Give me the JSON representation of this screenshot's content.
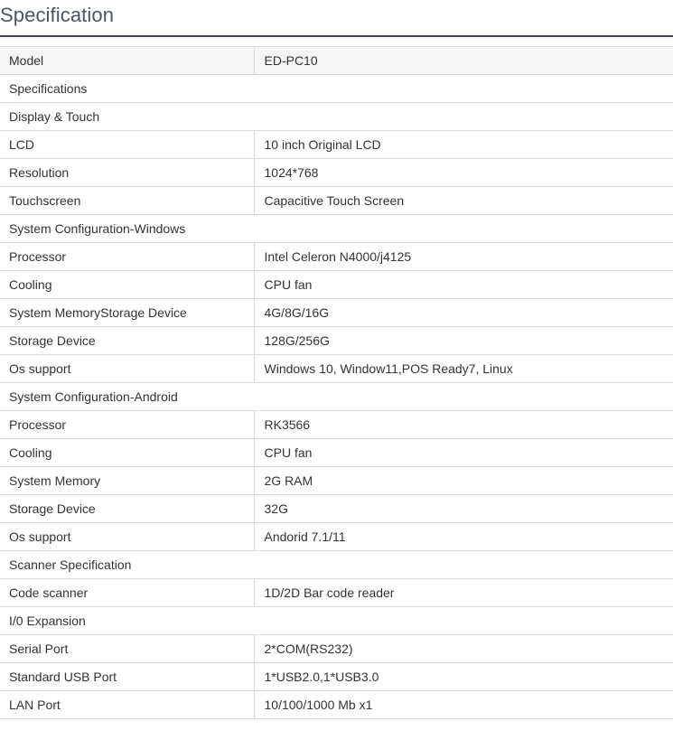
{
  "page": {
    "title": "Specification"
  },
  "table": {
    "rows": [
      {
        "type": "pair",
        "label": "Model",
        "value": "ED-PC10",
        "highlight": true
      },
      {
        "type": "section",
        "label": "Specifications"
      },
      {
        "type": "section",
        "label": "Display & Touch"
      },
      {
        "type": "pair",
        "label": "LCD",
        "value": "10 inch Original LCD"
      },
      {
        "type": "pair",
        "label": "Resolution",
        "value": "1024*768"
      },
      {
        "type": "pair",
        "label": "Touchscreen",
        "value": "Capacitive Touch Screen"
      },
      {
        "type": "section",
        "label": "System Configuration-Windows"
      },
      {
        "type": "pair",
        "label": "Processor",
        "value": "Intel Celeron N4000/j4125"
      },
      {
        "type": "pair",
        "label": "Cooling",
        "value": "CPU fan"
      },
      {
        "type": "pair",
        "label": "System MemoryStorage Device",
        "value": "4G/8G/16G"
      },
      {
        "type": "pair",
        "label": "Storage Device",
        "value": "128G/256G"
      },
      {
        "type": "pair",
        "label": "Os support",
        "value": "Windows 10, Window11,POS Ready7, Linux"
      },
      {
        "type": "section",
        "label": "System Configuration-Android"
      },
      {
        "type": "pair",
        "label": "Processor",
        "value": "RK3566"
      },
      {
        "type": "pair",
        "label": "Cooling",
        "value": "CPU fan"
      },
      {
        "type": "pair",
        "label": "System Memory",
        "value": "2G RAM"
      },
      {
        "type": "pair",
        "label": "Storage Device",
        "value": "32G"
      },
      {
        "type": "pair",
        "label": "Os support",
        "value": "Andorid 7.1/11"
      },
      {
        "type": "section",
        "label": "Scanner Specification"
      },
      {
        "type": "pair",
        "label": "Code scanner",
        "value": "1D/2D Bar code reader"
      },
      {
        "type": "section",
        "label": "I/0 Expansion"
      },
      {
        "type": "pair",
        "label": "Serial Port",
        "value": "2*COM(RS232)"
      },
      {
        "type": "pair",
        "label": "Standard USB Port",
        "value": "1*USB2.0,1*USB3.0"
      },
      {
        "type": "pair",
        "label": "LAN Port",
        "value": "10/100/1000 Mb x1"
      }
    ]
  }
}
